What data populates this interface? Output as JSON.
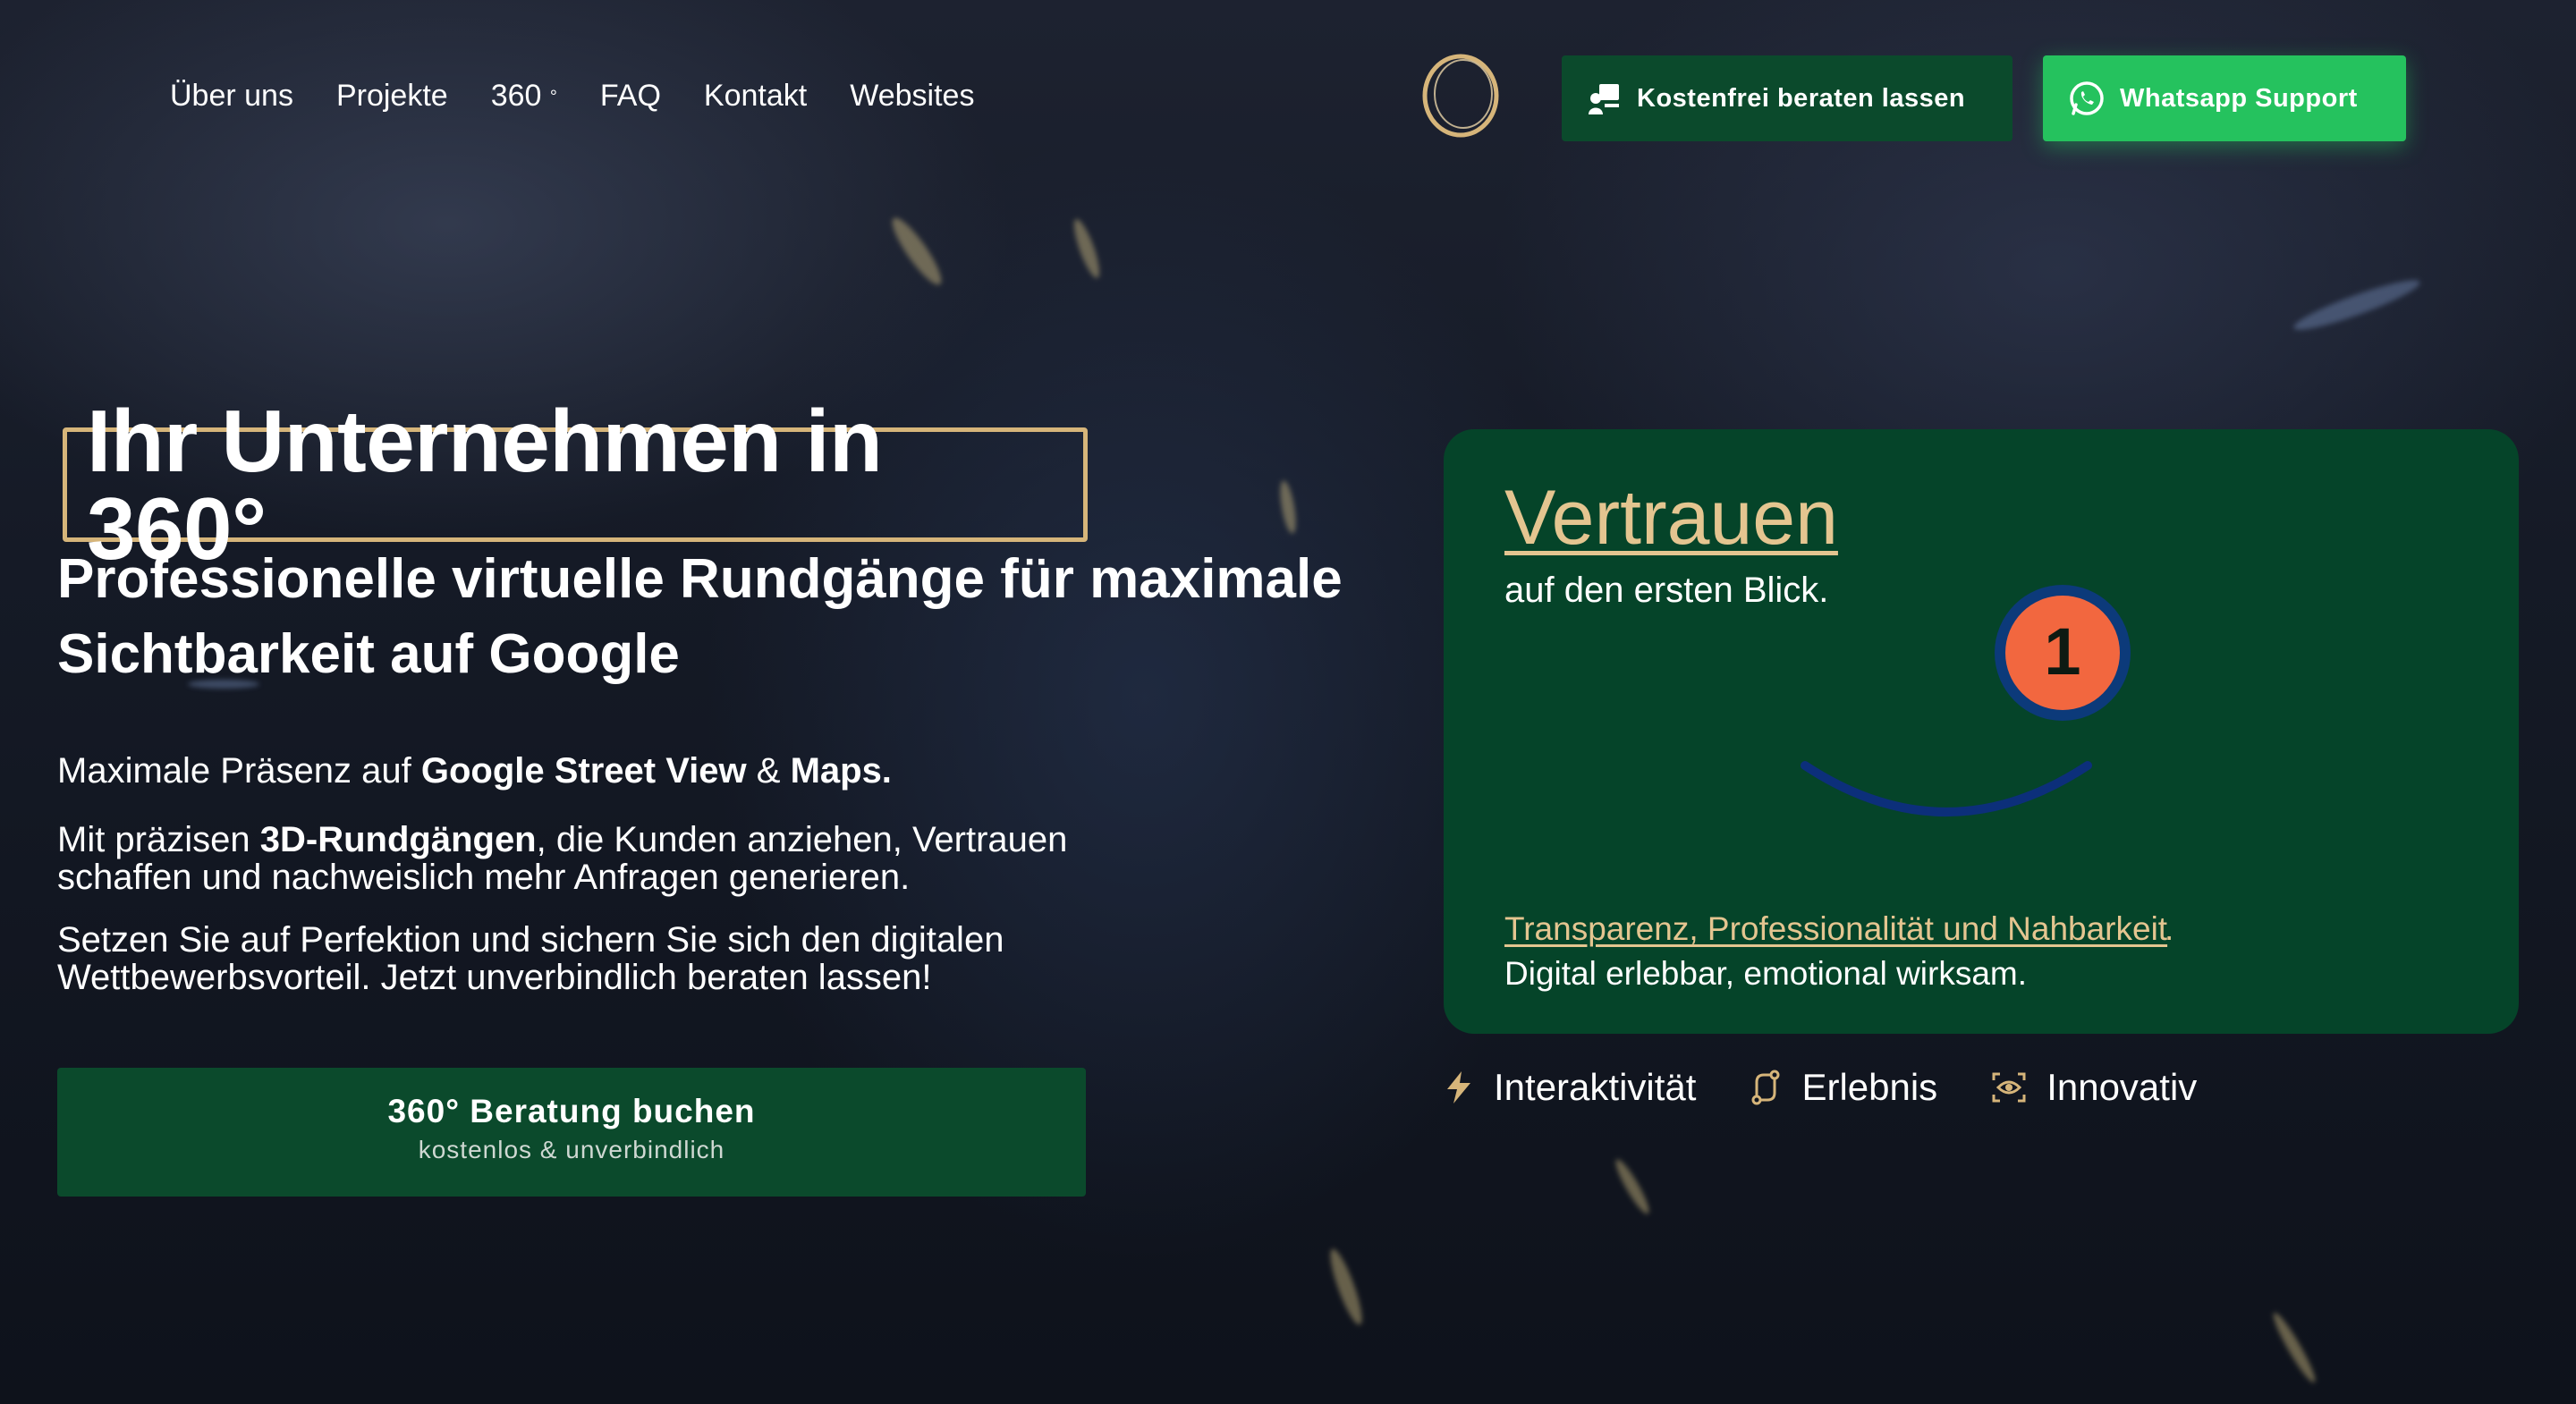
{
  "nav": {
    "items": [
      "Über uns",
      "Projekte",
      "360",
      "FAQ",
      "Kontakt",
      "Websites"
    ],
    "degree_glyph": "°"
  },
  "header": {
    "consult_button": "Kostenfrei beraten lassen",
    "whatsapp_button": "Whatsapp Support"
  },
  "hero": {
    "title": "Ihr Unternehmen in 360°",
    "subtitle": "Professionelle virtuelle Rundgänge für maximale Sichtbarkeit auf Google",
    "p1_prefix": "Maximale Präsenz auf ",
    "p1_bold1": "Google Street View",
    "p1_mid": " & ",
    "p1_bold2": "Maps.",
    "p2_prefix": "Mit präzisen ",
    "p2_bold": "3D-Rundgängen",
    "p2_suffix": ", die Kunden anziehen, Vertrauen schaffen und nachweislich mehr Anfragen generieren.",
    "p3": "Setzen Sie auf Perfektion und sichern Sie sich den digitalen Wettbewerbsvorteil. Jetzt unverbindlich beraten lassen!",
    "cta_main": "360° Beratung buchen",
    "cta_sub": "kostenlos & unverbindlich"
  },
  "card": {
    "title": "Vertrauen",
    "subtitle": "auf den ersten Blick.",
    "badge_number": "1",
    "link_text": "Transparenz, Professionalität und Nahbarkeit",
    "link_suffix": ".",
    "description": "Digital erlebbar, emotional wirksam."
  },
  "features": [
    {
      "label": "Interaktivität",
      "icon": "lightning-icon"
    },
    {
      "label": "Erlebnis",
      "icon": "route-icon"
    },
    {
      "label": "Innovativ",
      "icon": "eye-scan-icon"
    }
  ],
  "colors": {
    "accent_gold": "#d6b57a",
    "brand_green": "#0b4a2c",
    "whatsapp_green": "#25c25e",
    "card_green": "#054429",
    "badge_orange": "#f2673f",
    "badge_blue": "#0c3a7a"
  }
}
